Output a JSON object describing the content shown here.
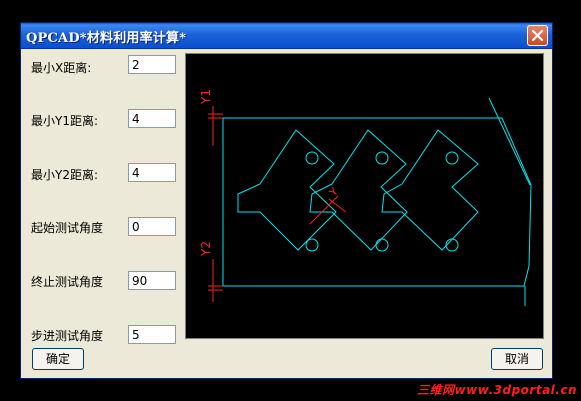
{
  "window": {
    "title": "QPCAD*材料利用率计算*"
  },
  "fields": [
    {
      "label": "最小X距离:",
      "value": "2"
    },
    {
      "label": "最小Y1距离:",
      "value": "4"
    },
    {
      "label": "最小Y2距离:",
      "value": "4"
    },
    {
      "label": "起始测试角度",
      "value": "0"
    },
    {
      "label": "终止测试角度",
      "value": "90"
    },
    {
      "label": "步进测试角度",
      "value": "5"
    }
  ],
  "canvas": {
    "labels": {
      "y1": "Y1",
      "y2": "Y2",
      "y": "Y"
    },
    "colors": {
      "background": "#000000",
      "outline": "#00e5ee",
      "dimension": "#ff2020"
    }
  },
  "buttons": {
    "ok": "确定",
    "cancel": "取消"
  },
  "watermark": "三维网www.3dportal.cn"
}
